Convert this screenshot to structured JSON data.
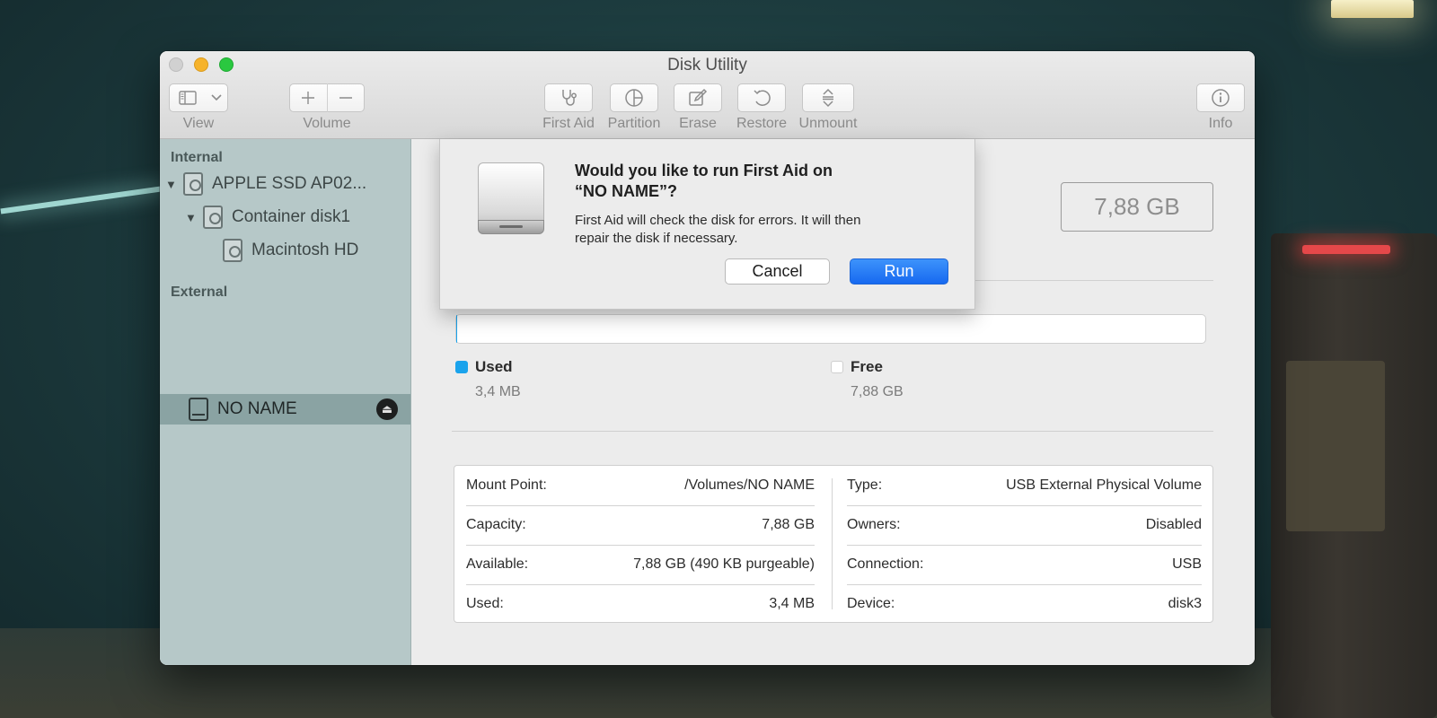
{
  "window": {
    "title": "Disk Utility"
  },
  "toolbar": {
    "view_label": "View",
    "volume_label": "Volume",
    "first_aid_label": "First Aid",
    "partition_label": "Partition",
    "erase_label": "Erase",
    "restore_label": "Restore",
    "unmount_label": "Unmount",
    "info_label": "Info"
  },
  "sidebar": {
    "internal_header": "Internal",
    "external_header": "External",
    "items": [
      {
        "label": "APPLE SSD AP02..."
      },
      {
        "label": "Container disk1"
      },
      {
        "label": "Macintosh HD"
      },
      {
        "label": "NO NAME"
      }
    ]
  },
  "volume": {
    "capacity": "7,88 GB",
    "used_fraction": 0.0004
  },
  "legend": {
    "used_label": "Used",
    "used_value": "3,4 MB",
    "used_color": "#1aa3ec",
    "free_label": "Free",
    "free_value": "7,88 GB",
    "free_color": "#ffffff"
  },
  "info": {
    "left": [
      {
        "key": "Mount Point:",
        "value": "/Volumes/NO NAME"
      },
      {
        "key": "Capacity:",
        "value": "7,88 GB"
      },
      {
        "key": "Available:",
        "value": "7,88 GB (490 KB purgeable)"
      },
      {
        "key": "Used:",
        "value": "3,4 MB"
      }
    ],
    "right": [
      {
        "key": "Type:",
        "value": "USB External Physical Volume"
      },
      {
        "key": "Owners:",
        "value": "Disabled"
      },
      {
        "key": "Connection:",
        "value": "USB"
      },
      {
        "key": "Device:",
        "value": "disk3"
      }
    ]
  },
  "dialog": {
    "title_line1": "Would you like to run First Aid on",
    "title_line2": "“NO NAME”?",
    "message_line1": "First Aid will check the disk for errors. It will then",
    "message_line2": "repair the disk if necessary.",
    "cancel_label": "Cancel",
    "run_label": "Run"
  }
}
